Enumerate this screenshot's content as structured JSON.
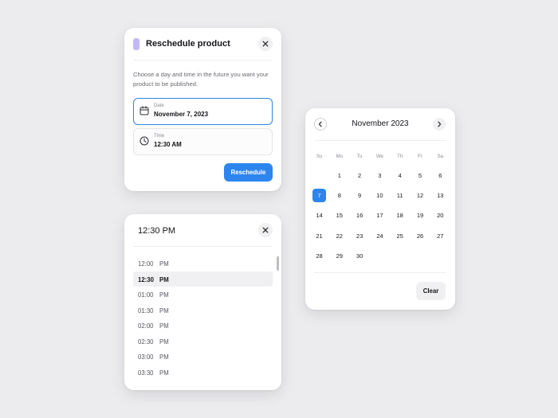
{
  "reschedule": {
    "title": "Reschedule product",
    "description": "Choose a day and time in the future you want your product to be published.",
    "date_label": "Date",
    "date_value": "November 7, 2023",
    "time_label": "Time",
    "time_value": "12:30 AM",
    "submit_label": "Reschedule",
    "close_icon": "close-icon"
  },
  "timepicker": {
    "title": "12:30 PM",
    "selected_index": 1,
    "times": [
      {
        "time": "12:00",
        "ampm": "PM"
      },
      {
        "time": "12:30",
        "ampm": "PM"
      },
      {
        "time": "01:00",
        "ampm": "PM"
      },
      {
        "time": "01:30",
        "ampm": "PM"
      },
      {
        "time": "02:00",
        "ampm": "PM"
      },
      {
        "time": "02:30",
        "ampm": "PM"
      },
      {
        "time": "03:00",
        "ampm": "PM"
      },
      {
        "time": "03:30",
        "ampm": "PM"
      }
    ]
  },
  "calendar": {
    "title": "November 2023",
    "weekdays": [
      "Su",
      "Mo",
      "Tu",
      "We",
      "Th",
      "Fr",
      "Sa"
    ],
    "first_weekday_index": 1,
    "days_in_month": 30,
    "selected_day": 7,
    "clear_label": "Clear"
  },
  "colors": {
    "accent": "#2d86ee",
    "title_marker": "#c4b8f5",
    "background": "#ececee"
  }
}
